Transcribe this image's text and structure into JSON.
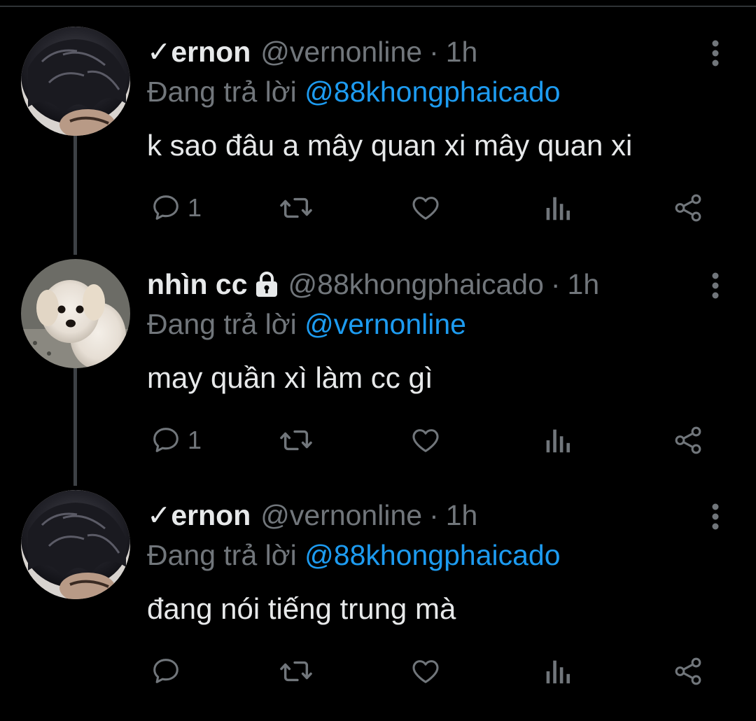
{
  "thread": {
    "tweets": [
      {
        "display_name": "✓ernon",
        "handle": "@vernonline",
        "separator": "·",
        "time": "1h",
        "locked": false,
        "reply_prefix": "Đang trả lời",
        "reply_to": "@88khongphaicado",
        "text": "k sao đâu a mây quan xi mây quan xi",
        "reply_count": "1",
        "avatar": "avatar-dark-hair"
      },
      {
        "display_name": "nhìn cc",
        "handle": "@88khongphaicado",
        "separator": "·",
        "time": "1h",
        "locked": true,
        "reply_prefix": "Đang trả lời",
        "reply_to": "@vernonline",
        "text": "may quần xì làm cc gì",
        "reply_count": "1",
        "avatar": "avatar-white-dog"
      },
      {
        "display_name": "✓ernon",
        "handle": "@vernonline",
        "separator": "·",
        "time": "1h",
        "locked": false,
        "reply_prefix": "Đang trả lời",
        "reply_to": "@88khongphaicado",
        "text": "đang nói tiếng trung mà",
        "reply_count": "",
        "avatar": "avatar-dark-hair"
      }
    ]
  },
  "colors": {
    "background": "#000000",
    "primary_text": "#e7e9ea",
    "secondary_text": "#71767b",
    "link": "#1d9bf0",
    "thread_line": "#3d4145"
  },
  "icons": [
    "comment-icon",
    "retweet-icon",
    "heart-icon",
    "analytics-icon",
    "share-icon",
    "more-icon",
    "lock-icon"
  ]
}
